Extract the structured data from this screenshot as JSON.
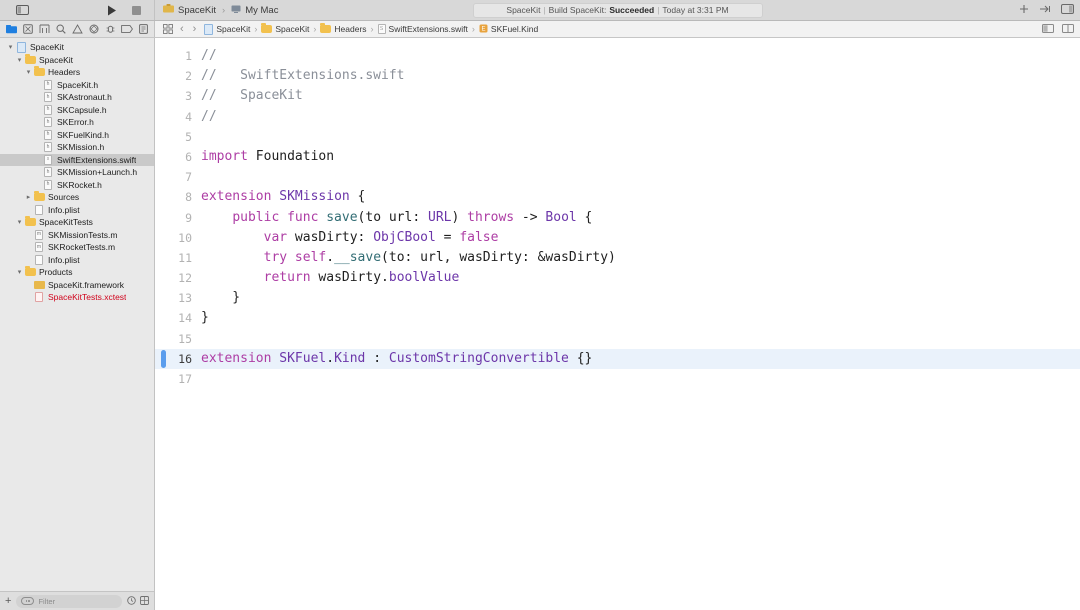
{
  "toolbar": {
    "sidebar_toggle_icon": "sidebar-toggle-icon",
    "run_icon": "run-icon",
    "stop_icon": "stop-icon",
    "scheme_name": "SpaceKit",
    "scheme_separator": "›",
    "destination_name": "My Mac",
    "status": {
      "project": "SpaceKit",
      "action": "Build SpaceKit:",
      "result": "Succeeded",
      "time": "Today at 3:31 PM",
      "separator": "|"
    },
    "add_icon": "plus-icon",
    "toggle_editor_icon": "editor-options-icon",
    "inspector_icon": "inspector-toggle-icon"
  },
  "navigator_tabs": [
    {
      "name": "project-navigator",
      "icon": "folder-icon",
      "selected": true
    },
    {
      "name": "source-control-navigator",
      "icon": "source-control-icon",
      "selected": false
    },
    {
      "name": "symbol-navigator",
      "icon": "symbol-icon",
      "selected": false
    },
    {
      "name": "find-navigator",
      "icon": "search-icon",
      "selected": false
    },
    {
      "name": "issue-navigator",
      "icon": "warning-icon",
      "selected": false
    },
    {
      "name": "test-navigator",
      "icon": "test-diamond-icon",
      "selected": false
    },
    {
      "name": "debug-navigator",
      "icon": "debug-icon",
      "selected": false
    },
    {
      "name": "breakpoint-navigator",
      "icon": "breakpoint-icon",
      "selected": false
    },
    {
      "name": "report-navigator",
      "icon": "report-icon",
      "selected": false
    }
  ],
  "jumpbar": {
    "related_items_icon": "related-items-icon",
    "back_icon": "‹",
    "forward_icon": "›",
    "separator": "›",
    "crumbs": [
      {
        "label": "SpaceKit",
        "icon": "project-icon"
      },
      {
        "label": "SpaceKit",
        "icon": "folder-icon"
      },
      {
        "label": "Headers",
        "icon": "folder-icon"
      },
      {
        "label": "SwiftExtensions.swift",
        "icon": "swift-file-icon"
      },
      {
        "label": "SKFuel.Kind",
        "icon": "extension-symbol-icon"
      }
    ],
    "assistant_icon": "assistant-editor-icon",
    "version_icon": "version-editor-icon"
  },
  "navigator": {
    "selected_row": "SwiftExtensions.swift",
    "rows": [
      {
        "label": "SpaceKit",
        "depth": 0,
        "twist": "down",
        "icon": "project-icon",
        "selected": false,
        "red": false
      },
      {
        "label": "SpaceKit",
        "depth": 1,
        "twist": "down",
        "icon": "folder-icon",
        "selected": false,
        "red": false
      },
      {
        "label": "Headers",
        "depth": 2,
        "twist": "down",
        "icon": "folder-icon",
        "selected": false,
        "red": false
      },
      {
        "label": "SpaceKit.h",
        "depth": 3,
        "twist": "none",
        "icon": "header-file-icon",
        "selected": false,
        "red": false
      },
      {
        "label": "SKAstronaut.h",
        "depth": 3,
        "twist": "none",
        "icon": "header-file-icon",
        "selected": false,
        "red": false
      },
      {
        "label": "SKCapsule.h",
        "depth": 3,
        "twist": "none",
        "icon": "header-file-icon",
        "selected": false,
        "red": false
      },
      {
        "label": "SKError.h",
        "depth": 3,
        "twist": "none",
        "icon": "header-file-icon",
        "selected": false,
        "red": false
      },
      {
        "label": "SKFuelKind.h",
        "depth": 3,
        "twist": "none",
        "icon": "header-file-icon",
        "selected": false,
        "red": false
      },
      {
        "label": "SKMission.h",
        "depth": 3,
        "twist": "none",
        "icon": "header-file-icon",
        "selected": false,
        "red": false
      },
      {
        "label": "SwiftExtensions.swift",
        "depth": 3,
        "twist": "none",
        "icon": "swift-file-icon",
        "selected": true,
        "red": false
      },
      {
        "label": "SKMission+Launch.h",
        "depth": 3,
        "twist": "none",
        "icon": "header-file-icon",
        "selected": false,
        "red": false
      },
      {
        "label": "SKRocket.h",
        "depth": 3,
        "twist": "none",
        "icon": "header-file-icon",
        "selected": false,
        "red": false
      },
      {
        "label": "Sources",
        "depth": 2,
        "twist": "right",
        "icon": "folder-icon",
        "selected": false,
        "red": false
      },
      {
        "label": "Info.plist",
        "depth": 2,
        "twist": "none",
        "icon": "plist-file-icon",
        "selected": false,
        "red": false
      },
      {
        "label": "SpaceKitTests",
        "depth": 1,
        "twist": "down",
        "icon": "folder-icon",
        "selected": false,
        "red": false
      },
      {
        "label": "SKMissionTests.m",
        "depth": 2,
        "twist": "none",
        "icon": "objc-file-icon",
        "selected": false,
        "red": false
      },
      {
        "label": "SKRocketTests.m",
        "depth": 2,
        "twist": "none",
        "icon": "objc-file-icon",
        "selected": false,
        "red": false
      },
      {
        "label": "Info.plist",
        "depth": 2,
        "twist": "none",
        "icon": "plist-file-icon",
        "selected": false,
        "red": false
      },
      {
        "label": "Products",
        "depth": 1,
        "twist": "down",
        "icon": "folder-icon",
        "selected": false,
        "red": false
      },
      {
        "label": "SpaceKit.framework",
        "depth": 2,
        "twist": "none",
        "icon": "framework-icon",
        "selected": false,
        "red": false
      },
      {
        "label": "SpaceKitTests.xctest",
        "depth": 2,
        "twist": "none",
        "icon": "xctest-icon",
        "selected": false,
        "red": true
      }
    ],
    "footer": {
      "add_label": "+",
      "filter_placeholder": "Filter",
      "recent_icon": "clock-icon",
      "sourcecontrol_icon": "source-control-filter-icon"
    }
  },
  "editor": {
    "highlighted_line": 16,
    "lines": [
      {
        "n": 1,
        "tokens": [
          {
            "t": "//",
            "c": "cm"
          }
        ]
      },
      {
        "n": 2,
        "tokens": [
          {
            "t": "//   SwiftExtensions.swift",
            "c": "cm"
          }
        ]
      },
      {
        "n": 3,
        "tokens": [
          {
            "t": "//   SpaceKit",
            "c": "cm"
          }
        ]
      },
      {
        "n": 4,
        "tokens": [
          {
            "t": "//",
            "c": "cm"
          }
        ]
      },
      {
        "n": 5,
        "tokens": []
      },
      {
        "n": 6,
        "tokens": [
          {
            "t": "import",
            "c": "k"
          },
          {
            "t": " Foundation",
            "c": "pl"
          }
        ]
      },
      {
        "n": 7,
        "tokens": []
      },
      {
        "n": 8,
        "tokens": [
          {
            "t": "extension",
            "c": "k"
          },
          {
            "t": " ",
            "c": "pl"
          },
          {
            "t": "SKMission",
            "c": "ty"
          },
          {
            "t": " {",
            "c": "pl"
          }
        ]
      },
      {
        "n": 9,
        "tokens": [
          {
            "t": "    ",
            "c": "pl"
          },
          {
            "t": "public func",
            "c": "k"
          },
          {
            "t": " ",
            "c": "pl"
          },
          {
            "t": "save",
            "c": "fn"
          },
          {
            "t": "(to url: ",
            "c": "pl"
          },
          {
            "t": "URL",
            "c": "ty"
          },
          {
            "t": ") ",
            "c": "pl"
          },
          {
            "t": "throws",
            "c": "k"
          },
          {
            "t": " -> ",
            "c": "pl"
          },
          {
            "t": "Bool",
            "c": "ty"
          },
          {
            "t": " {",
            "c": "pl"
          }
        ]
      },
      {
        "n": 10,
        "tokens": [
          {
            "t": "        ",
            "c": "pl"
          },
          {
            "t": "var",
            "c": "k"
          },
          {
            "t": " wasDirty: ",
            "c": "pl"
          },
          {
            "t": "ObjCBool",
            "c": "ty"
          },
          {
            "t": " = ",
            "c": "pl"
          },
          {
            "t": "false",
            "c": "k"
          }
        ]
      },
      {
        "n": 11,
        "tokens": [
          {
            "t": "        ",
            "c": "pl"
          },
          {
            "t": "try self",
            "c": "k"
          },
          {
            "t": ".",
            "c": "pl"
          },
          {
            "t": "__save",
            "c": "fn"
          },
          {
            "t": "(to: url, wasDirty: &wasDirty)",
            "c": "pl"
          }
        ]
      },
      {
        "n": 12,
        "tokens": [
          {
            "t": "        ",
            "c": "pl"
          },
          {
            "t": "return",
            "c": "k"
          },
          {
            "t": " wasDirty.",
            "c": "pl"
          },
          {
            "t": "boolValue",
            "c": "ty"
          }
        ]
      },
      {
        "n": 13,
        "tokens": [
          {
            "t": "    }",
            "c": "pl"
          }
        ]
      },
      {
        "n": 14,
        "tokens": [
          {
            "t": "}",
            "c": "pl"
          }
        ]
      },
      {
        "n": 15,
        "tokens": []
      },
      {
        "n": 16,
        "tokens": [
          {
            "t": "extension",
            "c": "k"
          },
          {
            "t": " ",
            "c": "pl"
          },
          {
            "t": "SKFuel",
            "c": "ty"
          },
          {
            "t": ".",
            "c": "pl"
          },
          {
            "t": "Kind",
            "c": "ty"
          },
          {
            "t": " : ",
            "c": "pl"
          },
          {
            "t": "CustomStringConvertible",
            "c": "ty"
          },
          {
            "t": " {}",
            "c": "pl"
          }
        ]
      },
      {
        "n": 17,
        "tokens": []
      }
    ]
  },
  "colors": {
    "accent_blue": "#5a9ded",
    "highlight_line": "#eaf2fb",
    "keyword": "#ad3da4",
    "type": "#6c36a9",
    "function": "#326d74",
    "comment": "#8a8f98",
    "error_red": "#d0021b",
    "folder_yellow": "#f2c14e"
  }
}
